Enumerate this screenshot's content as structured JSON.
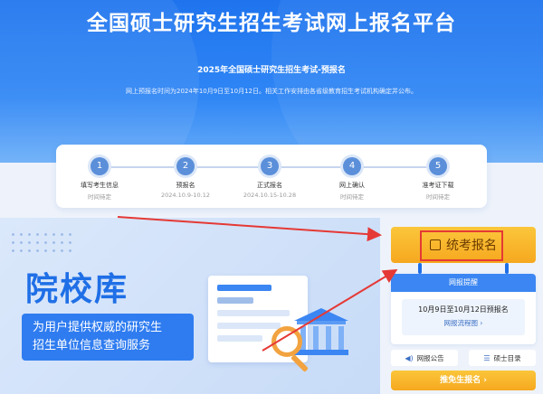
{
  "header": {
    "title": "全国硕士研究生招生考试网上报名平台",
    "subtitle": "2025年全国硕士研究生招生考试-预报名",
    "description": "网上预报名时间为2024年10月9日至10月12日。相关工作安排由各省级教育招生考试机构确定并公布。"
  },
  "steps": [
    {
      "num": "1",
      "name": "填写考生信息",
      "time": "时间待定"
    },
    {
      "num": "2",
      "name": "预报名",
      "time": "2024.10.9-10.12"
    },
    {
      "num": "3",
      "name": "正式报名",
      "time": "2024.10.15-10.28"
    },
    {
      "num": "4",
      "name": "网上确认",
      "time": "时间待定"
    },
    {
      "num": "5",
      "name": "准考证下载",
      "time": "时间待定"
    }
  ],
  "library": {
    "title": "院校库",
    "desc_line1": "为用户提供权威的研究生",
    "desc_line2": "招生单位信息查询服务"
  },
  "sidebar": {
    "main_button": "统考报名",
    "panel_title": "网报提醒",
    "panel_date": "10月9日至10月12日预报名",
    "panel_link": "网报流程图 ›",
    "notice_label": "网报公告",
    "catalog_label": "硕士目录",
    "alt_button": "推免生报名 ›"
  },
  "colors": {
    "primary": "#1f74ee",
    "accent": "#f6a81f",
    "highlight": "#e53935"
  },
  "icons": {
    "edit": "edit-icon",
    "speaker": "speaker-icon",
    "list": "list-icon"
  }
}
